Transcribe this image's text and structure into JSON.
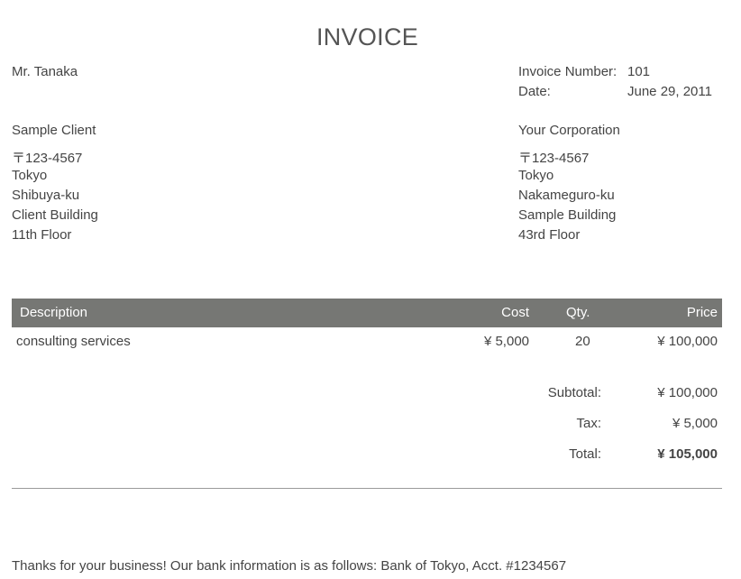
{
  "title": "INVOICE",
  "recipient_name": "Mr. Tanaka",
  "meta": {
    "invoice_number_label": "Invoice Number:",
    "invoice_number": "101",
    "date_label": "Date:",
    "date": "June 29, 2011"
  },
  "client": {
    "name": "Sample Client",
    "postal": "〒123-4567",
    "city": "Tokyo",
    "ward": "Shibuya-ku",
    "building": "Client Building",
    "floor": "11th Floor"
  },
  "company": {
    "name": "Your Corporation",
    "postal": "〒123-4567",
    "city": "Tokyo",
    "ward": "Nakameguro-ku",
    "building": "Sample Building",
    "floor": "43rd Floor"
  },
  "table": {
    "headers": {
      "description": "Description",
      "cost": "Cost",
      "qty": "Qty.",
      "price": "Price"
    },
    "rows": [
      {
        "description": "consulting services",
        "cost": "¥ 5,000",
        "qty": "20",
        "price": "¥ 100,000"
      }
    ]
  },
  "totals": {
    "subtotal_label": "Subtotal:",
    "subtotal": "¥ 100,000",
    "tax_label": "Tax:",
    "tax": "¥ 5,000",
    "total_label": "Total:",
    "total": "¥ 105,000"
  },
  "footer": "Thanks for your business! Our bank information is as follows: Bank of Tokyo, Acct. #1234567",
  "colors": {
    "header_background": "#767774",
    "text": "#444444",
    "divider": "#9a9a9a"
  }
}
